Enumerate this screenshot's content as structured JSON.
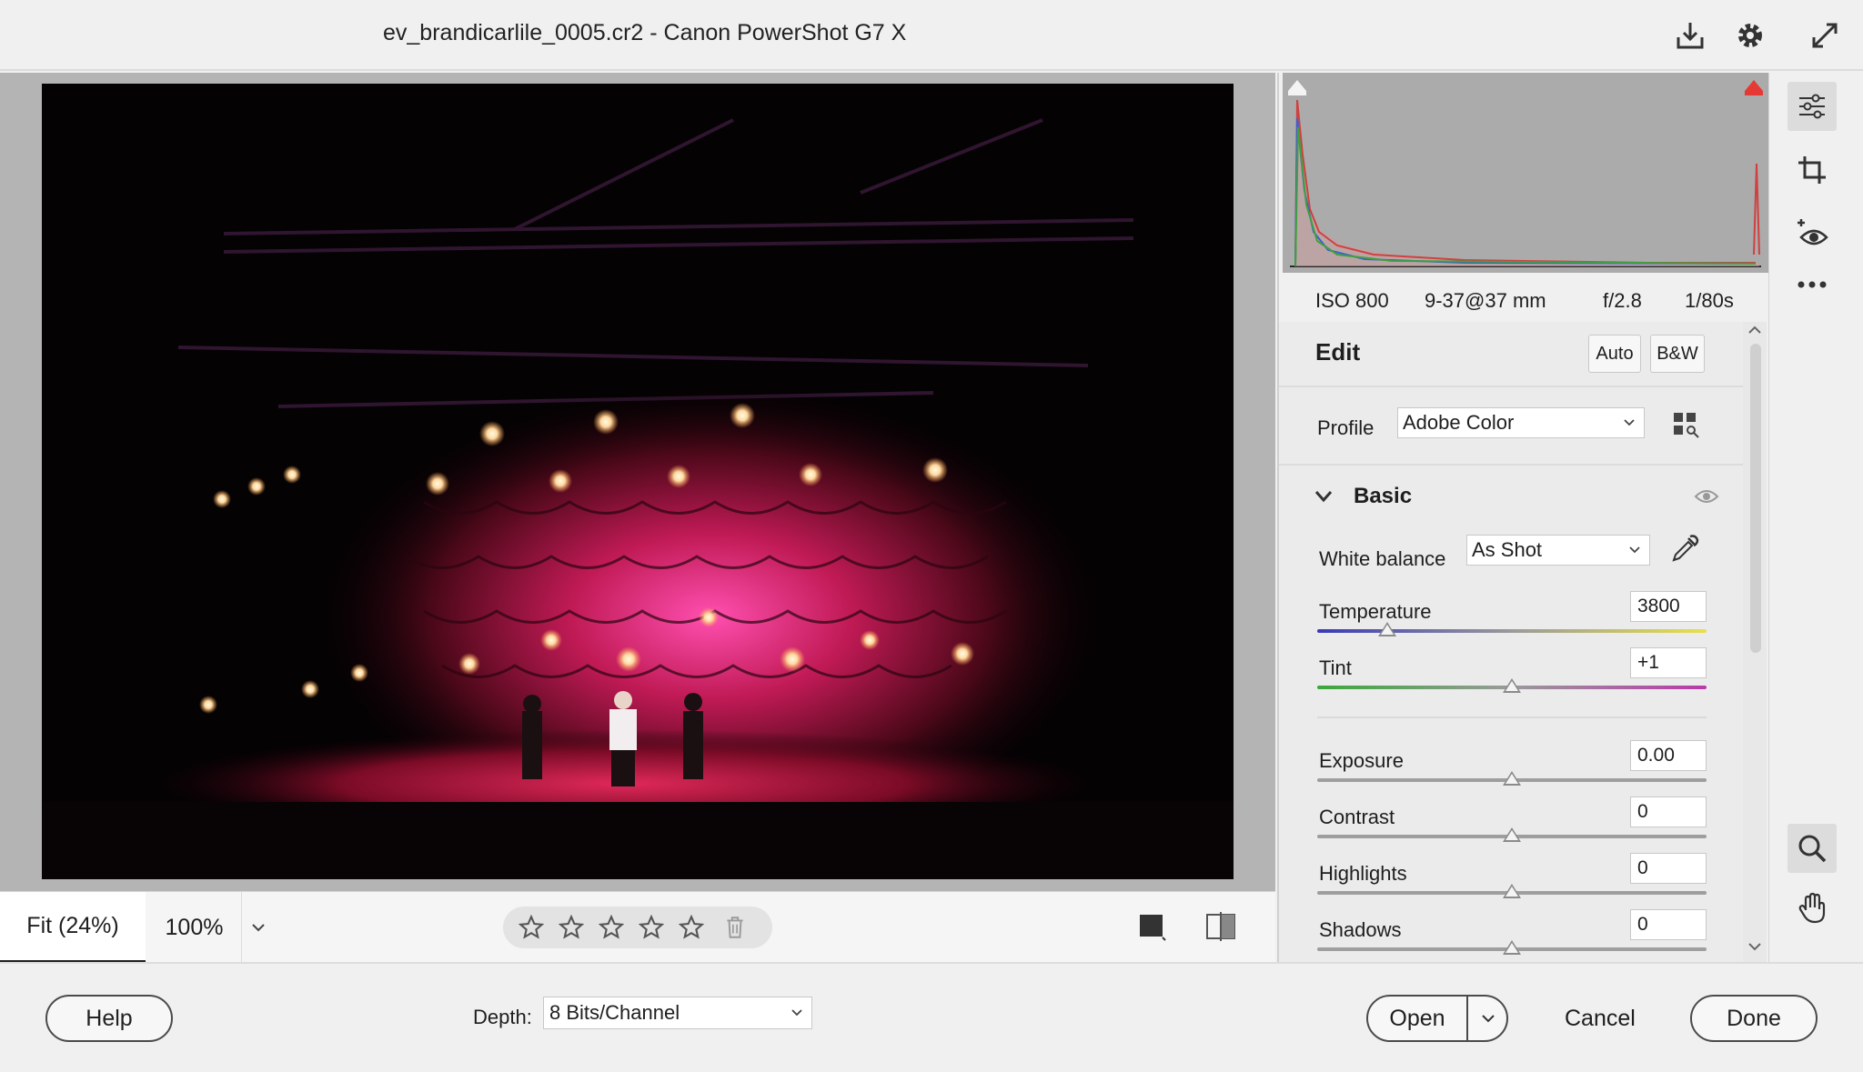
{
  "window": {
    "title": "ev_brandicarlile_0005.cr2  -  Canon PowerShot G7 X",
    "icons": [
      "save-icon",
      "gear-icon",
      "fullscreen-icon"
    ]
  },
  "exif": {
    "iso": "ISO 800",
    "lens": "9-37@37 mm",
    "aperture": "f/2.8",
    "shutter": "1/80s"
  },
  "edit": {
    "title": "Edit",
    "auto_label": "Auto",
    "bw_label": "B&W",
    "profile": {
      "label": "Profile",
      "value": "Adobe Color"
    },
    "basic": {
      "title": "Basic",
      "white_balance": {
        "label": "White balance",
        "value": "As Shot"
      },
      "sliders": [
        {
          "label": "Temperature",
          "value": "3800",
          "position": 0.18
        },
        {
          "label": "Tint",
          "value": "+1",
          "position": 0.5
        },
        {
          "label": "Exposure",
          "value": "0.00",
          "position": 0.5
        },
        {
          "label": "Contrast",
          "value": "0",
          "position": 0.5
        },
        {
          "label": "Highlights",
          "value": "0",
          "position": 0.5
        },
        {
          "label": "Shadows",
          "value": "0",
          "position": 0.5
        }
      ]
    }
  },
  "canvas_toolbar": {
    "zoom_fit": "Fit (24%)",
    "zoom_100": "100%",
    "rating_stars": 5
  },
  "footer": {
    "help_label": "Help",
    "depth_label": "Depth:",
    "depth_value": "8 Bits/Channel",
    "open_label": "Open",
    "cancel_label": "Cancel",
    "done_label": "Done"
  },
  "colors": {
    "accent_temperature_start": "#3a3ab8",
    "accent_temperature_end": "#e8e04a",
    "accent_tint_start": "#3aa83a",
    "accent_tint_end": "#b83aa8"
  }
}
